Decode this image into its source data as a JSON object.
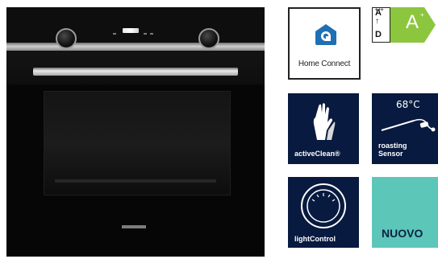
{
  "badges": {
    "home_connect": {
      "label": "Home Connect",
      "icon": "home-connect-icon"
    },
    "energy": {
      "scale_top": "A",
      "scale_top_plus": "+++",
      "scale_arrow": "↑",
      "scale_bottom": "D",
      "class": "A",
      "class_plus": "+",
      "class_color": "#8cc63f"
    },
    "active_clean": {
      "label": "activeClean®",
      "icon": "gloves-icon"
    },
    "roasting_sensor": {
      "label_line1": "roasting",
      "label_line2": "Sensor",
      "temperature": "68°C",
      "icon": "meat-probe-icon"
    },
    "light_control": {
      "label": "lightControl",
      "icon": "light-ring-icon"
    },
    "new": {
      "label": "NUOVO",
      "color": "#5cc6b9"
    }
  },
  "colors": {
    "feature_bg": "#081a3f",
    "oven_trim": "#cfcfcf"
  }
}
